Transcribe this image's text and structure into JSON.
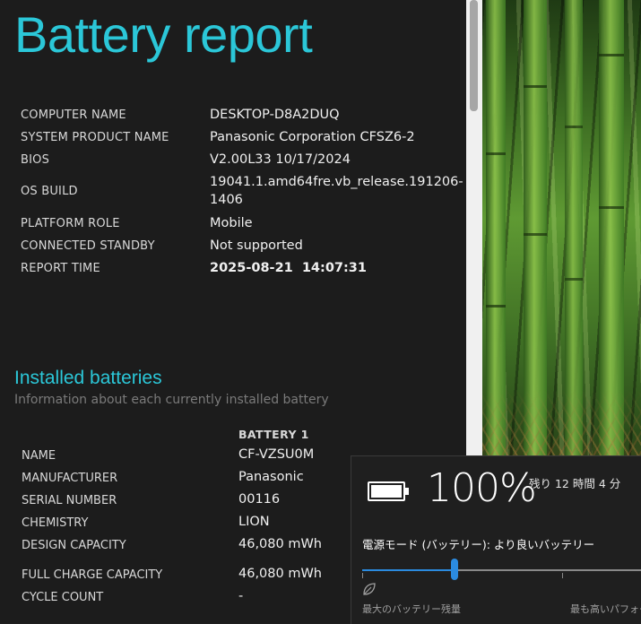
{
  "report": {
    "title": "Battery report",
    "system_info": [
      {
        "label": "COMPUTER NAME",
        "value": "DESKTOP-D8A2DUQ"
      },
      {
        "label": "SYSTEM PRODUCT NAME",
        "value": "Panasonic Corporation CFSZ6-2"
      },
      {
        "label": "BIOS",
        "value": "V2.00L33 10/17/2024"
      },
      {
        "label": "OS BUILD",
        "value": "19041.1.amd64fre.vb_release.191206-1406"
      },
      {
        "label": "PLATFORM ROLE",
        "value": "Mobile"
      },
      {
        "label": "CONNECTED STANDBY",
        "value": "Not supported"
      },
      {
        "label": "REPORT TIME",
        "value": "2025-08-21  14:07:31"
      }
    ],
    "installed": {
      "title": "Installed batteries",
      "subtitle": "Information about each currently installed battery",
      "column_header": "BATTERY 1",
      "rows": [
        {
          "label": "NAME",
          "value": "CF-VZSU0M"
        },
        {
          "label": "MANUFACTURER",
          "value": "Panasonic"
        },
        {
          "label": "SERIAL NUMBER",
          "value": "00116"
        },
        {
          "label": "CHEMISTRY",
          "value": "LION"
        },
        {
          "label": "DESIGN CAPACITY",
          "value": "46,080 mWh"
        },
        {
          "label": "FULL CHARGE CAPACITY",
          "value": "46,080 mWh"
        },
        {
          "label": "CYCLE COUNT",
          "value": "-"
        }
      ]
    }
  },
  "flyout": {
    "percent": "100%",
    "charge_level": 1.0,
    "remaining": "残り 12 時間 4 分",
    "power_mode": "電源モード (バッテリー): より良いバッテリー",
    "slider_left_label": "最大のバッテリー残量",
    "slider_right_label": "最も高いパフォー",
    "slider_value": 0.33,
    "accent_color": "#2b8be0",
    "icons": [
      "battery-icon",
      "battery-saver-leaf-icon"
    ]
  },
  "colors": {
    "title": "#2bc7d8",
    "background": "#1c1c1c"
  }
}
